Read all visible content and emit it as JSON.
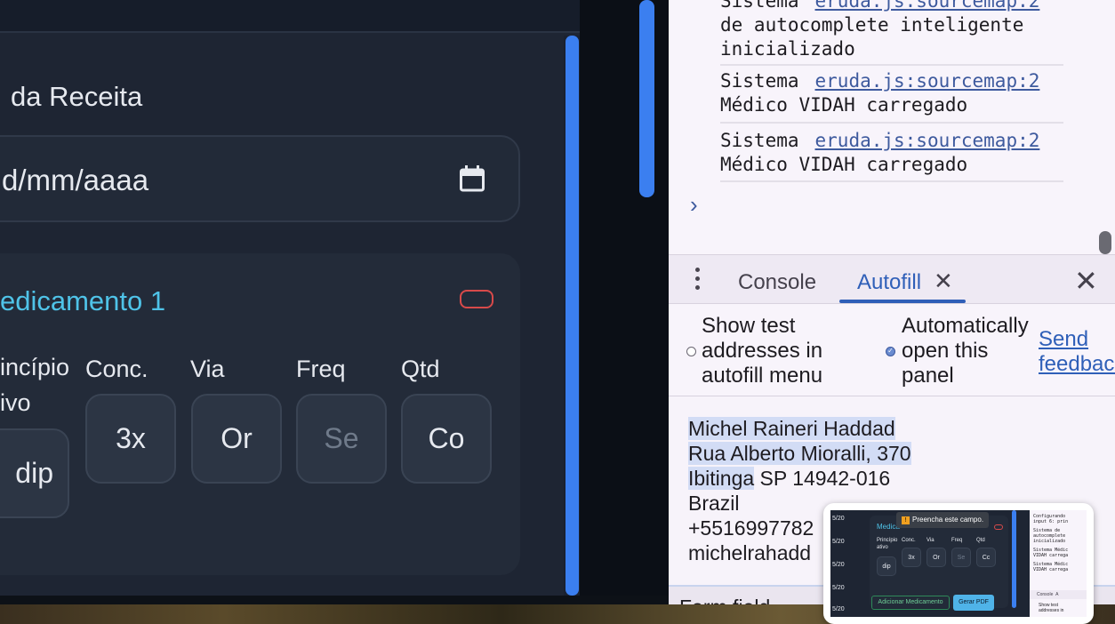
{
  "app": {
    "section_label": "da Receita",
    "date_placeholder": "d/mm/aaaa",
    "medication": {
      "title": "edicamento 1",
      "columns": [
        {
          "label_line1": "incípio",
          "label_line2": "ivo",
          "value": "dip"
        },
        {
          "label_line1": "Conc.",
          "label_line2": "",
          "value": "3x"
        },
        {
          "label_line1": "Via",
          "label_line2": "",
          "value": "Or"
        },
        {
          "label_line1": "Freq",
          "label_line2": "",
          "value": "Se"
        },
        {
          "label_line1": "Qtd",
          "label_line2": "",
          "value": "Co"
        }
      ]
    },
    "colors": {
      "accent": "#4fc3e8",
      "danger": "#d84a4a",
      "scrollbar": "#3b7ff0"
    }
  },
  "devtools": {
    "logs": [
      {
        "source": "Sistema",
        "link": "eruda.js:sourcemap:2",
        "message": "de autocomplete inteligente",
        "message2": "inicializado"
      },
      {
        "source": "Sistema",
        "link": "eruda.js:sourcemap:2",
        "message": "Médico VIDAH carregado"
      },
      {
        "source": "Sistema",
        "link": "eruda.js:sourcemap:2",
        "message": "Médico VIDAH carregado"
      }
    ],
    "tabs": {
      "console": "Console",
      "autofill": "Autofill"
    },
    "options": {
      "show_test_line1": "Show test",
      "show_test_line2": "addresses in",
      "show_test_line3": "autofill menu",
      "auto_open_line1": "Automatically",
      "auto_open_line2": "open this",
      "auto_open_line3": "panel",
      "feedback_line1": "Send",
      "feedback_line2": "feedback"
    },
    "address": {
      "name": "Michel Raineri Haddad",
      "street": "Rua Alberto Mioralli, 370",
      "city": "Ibitinga",
      "state_zip": " SP 14942-016",
      "country": "Brazil",
      "phone": "+5516997782",
      "email": "michelrahadd"
    },
    "form_field_label": "Form field"
  },
  "thumbnail": {
    "tooltip": "Preencha este campo.",
    "card_title": "Medica",
    "labels": [
      "Princípio",
      "ativo",
      "Conc.",
      "Via",
      "Freq",
      "Qtd"
    ],
    "pills": [
      "dip",
      "3x",
      "Or",
      "Se",
      "Cc"
    ],
    "dates": [
      "5/20",
      "5/20",
      "5/20",
      "5/20",
      "5/20"
    ],
    "add_button": "Adicionar Medicamento",
    "pdf_button": "Gerar PDF",
    "logs": [
      "Configurando",
      "input 6: prin",
      "Sistema de",
      "autocomplete",
      "inicializado",
      "Sistema Médic",
      "VIDAH carrega",
      "Sistema Médic",
      "VIDAH carrega"
    ],
    "tab_console": "Console",
    "tab_autofill": "A",
    "show_test": "Show test",
    "show_test2": "addresses in"
  }
}
